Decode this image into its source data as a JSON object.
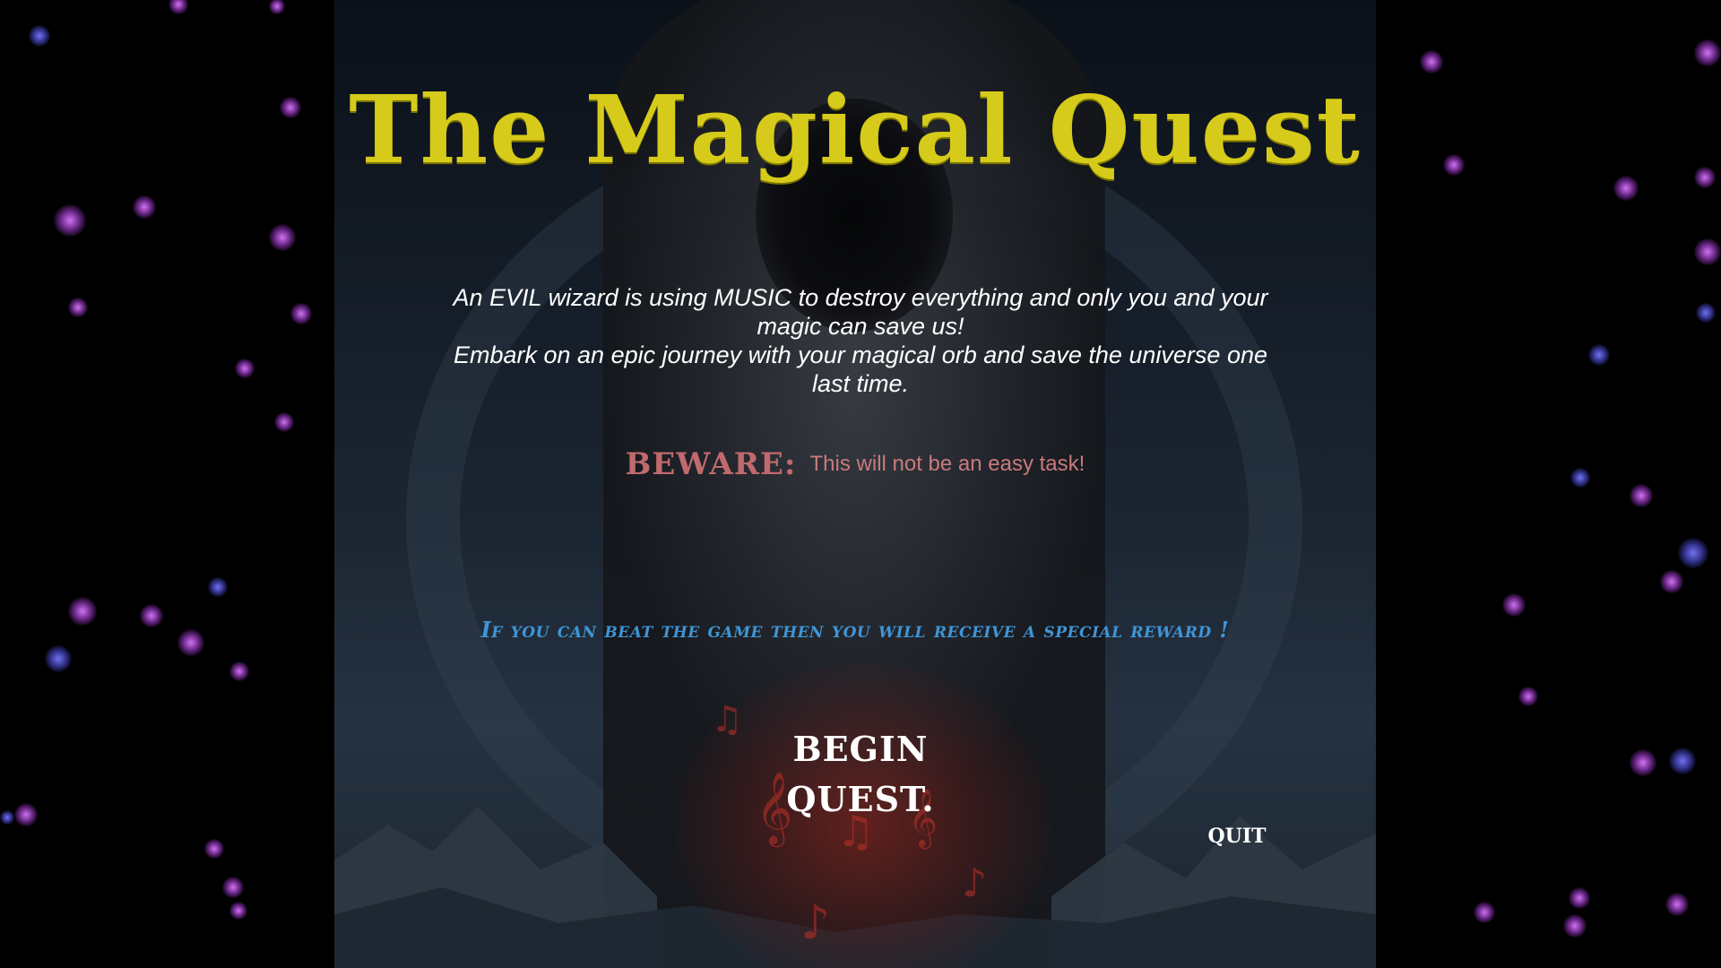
{
  "game": {
    "title": "The Magical Quest",
    "story_line_1": "An EVIL wizard is using MUSIC to destroy everything and only you and your magic can save us!",
    "story_line_2": "Embark on an epic journey with your magical orb and save the universe one last time.",
    "beware_label": "BEWARE:",
    "beware_text": "This will not be an easy task!",
    "reward_text": "If you can beat the game then you will receive a special reward !",
    "begin_button": "BEGIN QUEST.",
    "quit_button": "QUIT"
  },
  "colors": {
    "title": "#d6cb1a",
    "story": "#ffffff",
    "beware": "#c06a6e",
    "reward": "#3f95d6",
    "buttons": "#ffffff",
    "star_pink": "#c84fe6",
    "star_blue": "#5a5af0"
  }
}
